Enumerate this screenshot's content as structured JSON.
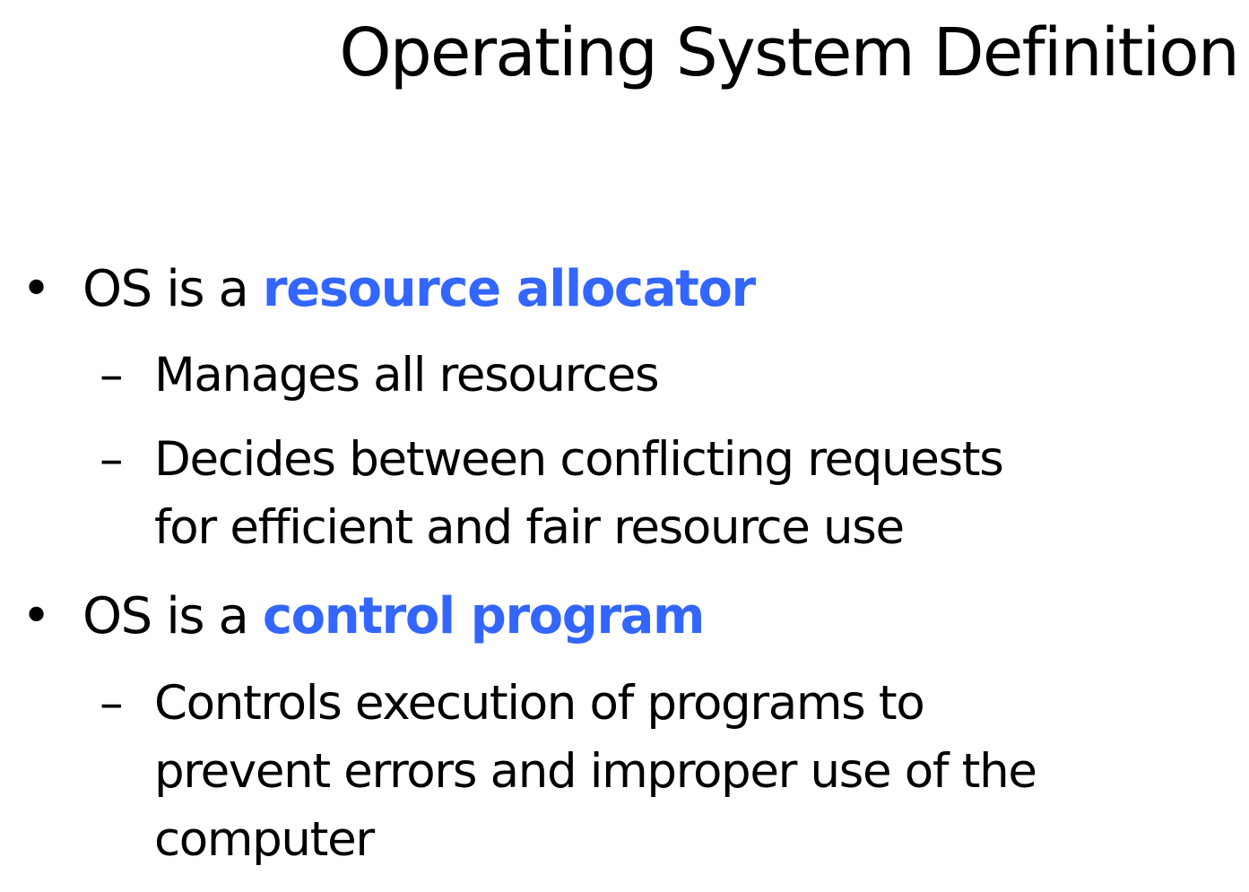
{
  "slide": {
    "title": "Operating System Definition",
    "accent_color": "#3366ff",
    "bullets": [
      {
        "marker": "•",
        "prefix": "OS is a ",
        "highlight": "resource allocator",
        "subitems": [
          {
            "marker": "–",
            "lines": [
              "Manages all resources"
            ]
          },
          {
            "marker": "–",
            "lines": [
              "Decides between conflicting requests",
              "for efficient and fair resource use"
            ]
          }
        ]
      },
      {
        "marker": "•",
        "prefix": "OS is a ",
        "highlight": "control program",
        "subitems": [
          {
            "marker": "–",
            "lines": [
              "Controls execution of programs to",
              "prevent errors and improper use of the",
              "computer"
            ]
          }
        ]
      }
    ]
  }
}
